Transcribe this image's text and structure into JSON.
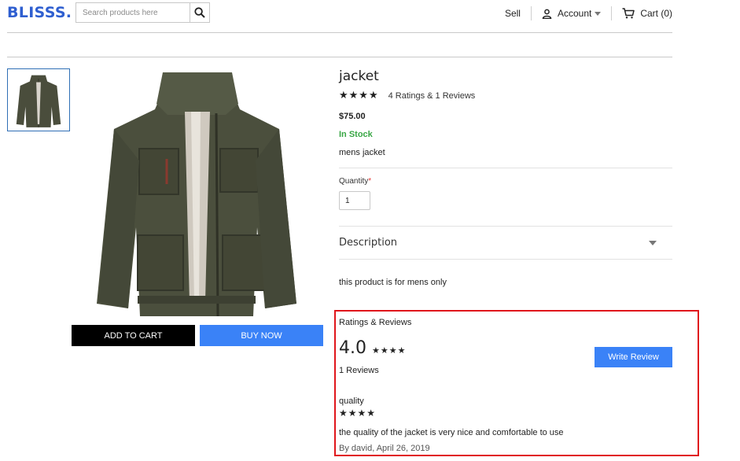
{
  "header": {
    "logo": "BLISSS.",
    "search_placeholder": "Search products here",
    "nav": {
      "sell": "Sell",
      "account": "Account",
      "cart": "Cart (0)"
    }
  },
  "gallery": {
    "add_to_cart": "ADD TO CART",
    "buy_now": "BUY NOW"
  },
  "product": {
    "title": "jacket",
    "stars": "★★★★",
    "rating_summary": "4 Ratings & 1 Reviews",
    "price": "$75.00",
    "stock": "In Stock",
    "short_description": "mens jacket",
    "quantity_label": "Quantity",
    "quantity_required_mark": "*",
    "quantity_value": "1",
    "description_heading": "Description",
    "description_body": "this product is for mens only"
  },
  "ratings": {
    "heading": "Ratings & Reviews",
    "average": "4.0",
    "stars": "★★★★",
    "review_count": "1 Reviews",
    "write_review": "Write Review",
    "reviews": [
      {
        "title": "quality",
        "stars": "★★★★",
        "body": "the quality of the jacket is very nice and comfortable to use",
        "byline": "By david, April 26, 2019"
      }
    ]
  },
  "colors": {
    "brand": "#2f5fd0",
    "primary_button": "#3a82f7",
    "in_stock": "#39a745",
    "highlight_border": "#e0161b"
  }
}
